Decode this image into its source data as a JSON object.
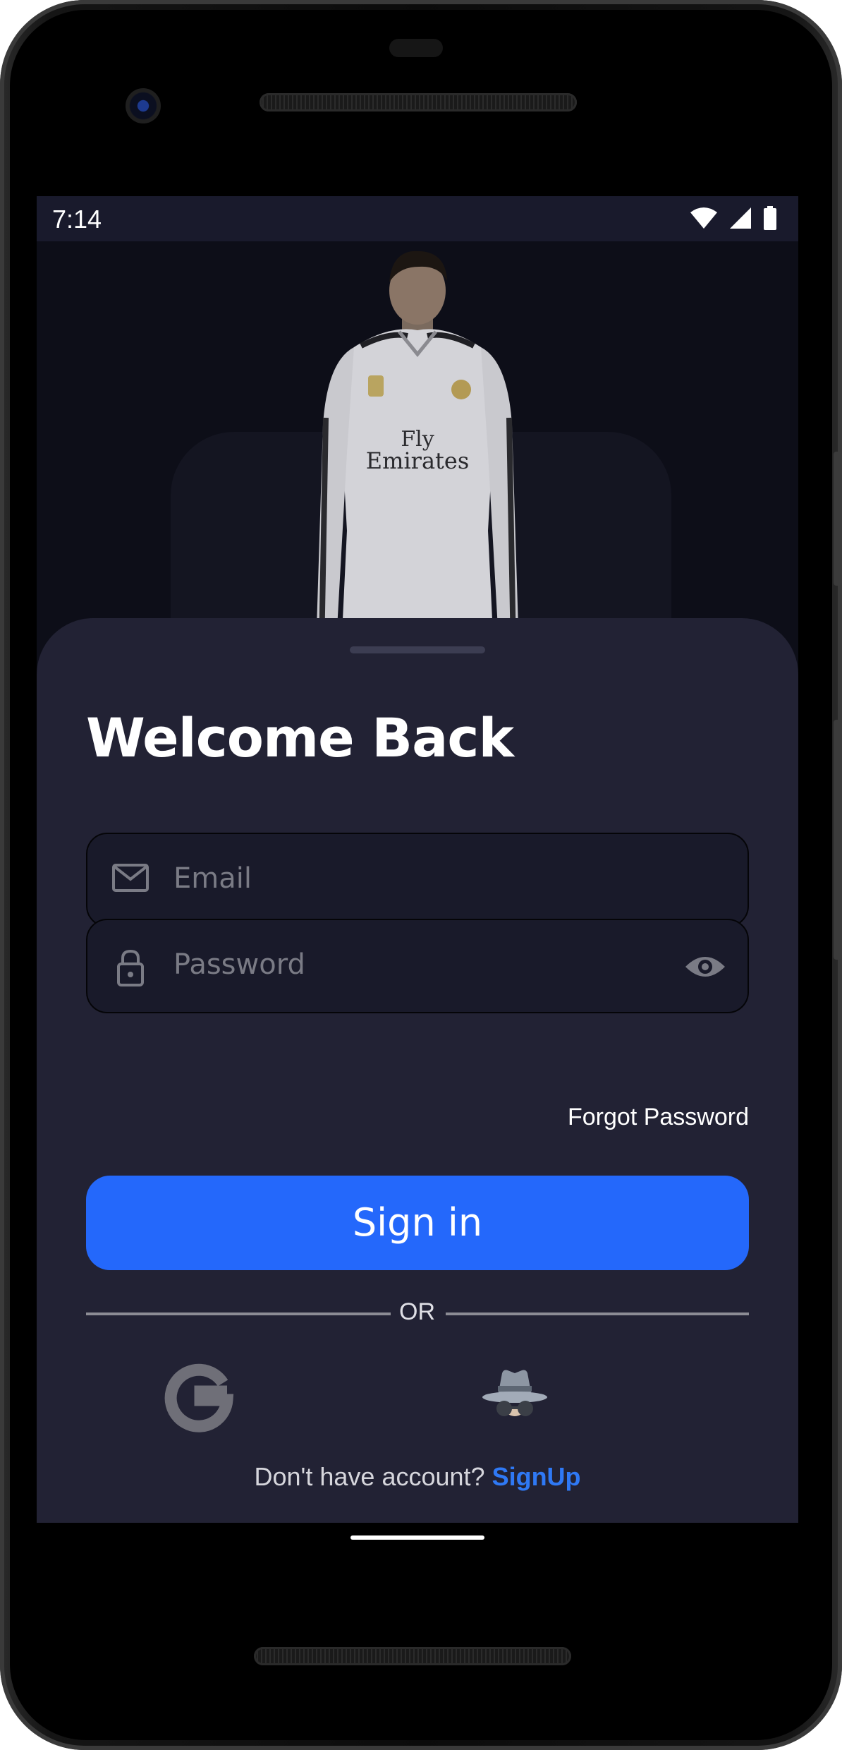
{
  "status_bar": {
    "time": "7:14"
  },
  "login": {
    "title": "Welcome Back",
    "email_placeholder": "Email",
    "password_placeholder": "Password",
    "forgot_password": "Forgot Password",
    "sign_in_button": "Sign in",
    "divider_text": "OR",
    "signup_prompt": "Don't have account?",
    "signup_link": "SignUp"
  },
  "icons": {
    "email": "mail-icon",
    "password": "lock-icon",
    "password_toggle": "eye-icon",
    "google": "google-icon",
    "guest": "incognito-icon"
  },
  "hero": {
    "jersey_text_1": "Fly",
    "jersey_text_2": "Emirates"
  },
  "colors": {
    "accent": "#2468fb",
    "sheet": "#222234",
    "background": "#0d0e18",
    "link": "#2f79f5"
  }
}
